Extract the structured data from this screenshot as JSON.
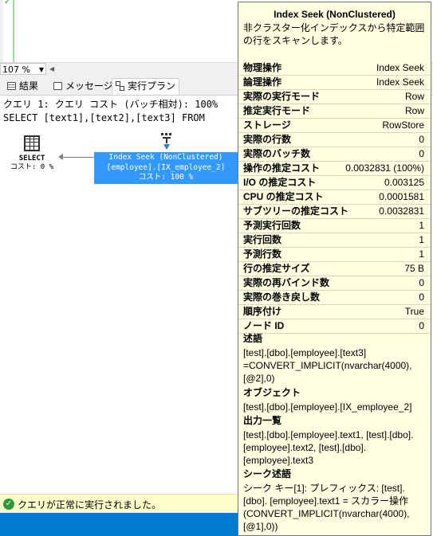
{
  "editor": {
    "zoom": "107 %"
  },
  "results_tabs": [
    {
      "label": "結果"
    },
    {
      "label": "メッセージ"
    },
    {
      "label": "実行プラン"
    }
  ],
  "query": {
    "line1": "クエリ 1: クエリ コスト (バッチ相対): 100%",
    "line2": "SELECT [text1],[text2],[text3] FROM"
  },
  "plan": {
    "select_node": {
      "name": "SELECT",
      "cost": "コスト: 0 %"
    },
    "seek_node": {
      "name": "Index Seek (NonClustered)",
      "object": "[employee].[IX_employee_2]",
      "cost": "コスト: 100 %"
    }
  },
  "tooltip": {
    "title": "Index Seek (NonClustered)",
    "description": "非クラスター化インデックスから特定範囲 の行をスキャンします。",
    "rows": [
      {
        "label": "物理操作",
        "value": "Index Seek"
      },
      {
        "label": "論理操作",
        "value": "Index Seek"
      },
      {
        "label": "実際の実行モード",
        "value": "Row"
      },
      {
        "label": "推定実行モード",
        "value": "Row"
      },
      {
        "label": "ストレージ",
        "value": "RowStore"
      },
      {
        "label": "実際の行数",
        "value": "0"
      },
      {
        "label": "実際のバッチ数",
        "value": "0"
      },
      {
        "label": "操作の推定コスト",
        "value": "0.0032831 (100%)"
      },
      {
        "label": "I/O の推定コスト",
        "value": "0.003125"
      },
      {
        "label": "CPU の推定コスト",
        "value": "0.0001581"
      },
      {
        "label": "サブツリーの推定コスト",
        "value": "0.0032831"
      },
      {
        "label": "予測実行回数",
        "value": "1"
      },
      {
        "label": "実行回数",
        "value": "1"
      },
      {
        "label": "予測行数",
        "value": "1"
      },
      {
        "label": "行の推定サイズ",
        "value": "75 B"
      },
      {
        "label": "実際の再バインド数",
        "value": "0"
      },
      {
        "label": "実際の巻き戻し数",
        "value": "0"
      },
      {
        "label": "順序付け",
        "value": "True"
      },
      {
        "label": "ノード ID",
        "value": "0"
      }
    ],
    "predicate_heading": "述語",
    "predicate": "[test].[dbo].[employee].[text3] =CONVERT_IMPLICIT(nvarchar(4000), [@2],0)",
    "object_heading": "オブジェクト",
    "object": "[test].[dbo].[employee].[IX_employee_2]",
    "output_heading": "出力一覧",
    "output": "[test].[dbo].[employee].text1, [test].[dbo]. [employee].text2, [test].[dbo]. [employee].text3",
    "seek_heading": "シーク述語",
    "seek": "シーク キー[1]: プレフィックス: [test].[dbo]. [employee].text1 = スカラー操作 (CONVERT_IMPLICIT(nvarchar(4000), [@1],0))"
  },
  "status": {
    "message": "クエリが正常に実行されました。"
  },
  "colors": {
    "accent": "#3399ff",
    "tooltip_bg": "#ffffe1",
    "status_bg": "#ffffcc",
    "bottom_bar": "#007acc",
    "success": "#2a9a3a"
  }
}
